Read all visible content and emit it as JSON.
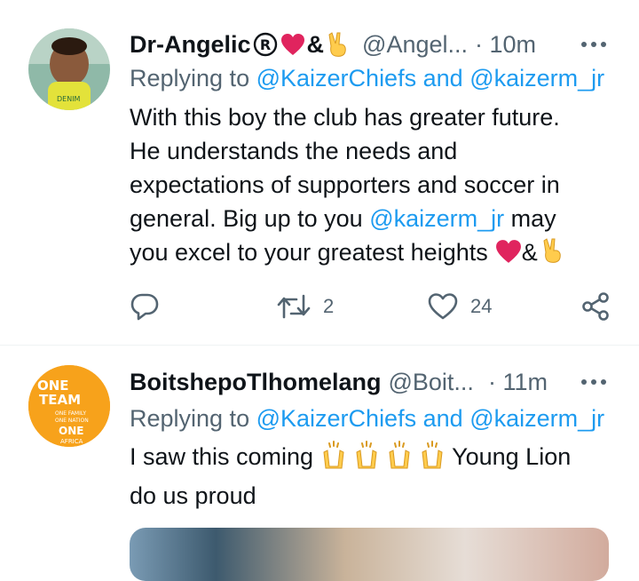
{
  "tweets": [
    {
      "name": "Dr-Angelic",
      "handle": "@Angel...",
      "time": "· 10m",
      "replying_prefix": "Replying to",
      "reply_user1": "@KaizerChiefs",
      "reply_and": "and",
      "reply_user2": "@kaizerm_jr",
      "body_lines": [
        "With this boy the club has greater future.",
        "He understands the needs and",
        "expectations of supporters and soccer in",
        "general. Big up to you",
        "@kaizerm_jr",
        "may",
        "you excel to your greatest heights"
      ],
      "amp": "&",
      "reply_count": "",
      "retweet_count": "2",
      "like_count": "24"
    },
    {
      "name": "BoitshepoTlhomelang",
      "handle": "@Boit...",
      "time": "· 11m",
      "replying_prefix": "Replying to",
      "reply_user1": "@KaizerChiefs",
      "reply_and": "and",
      "reply_user2": "@kaizerm_jr",
      "body_lines": [
        "I saw this coming",
        "Young Lion",
        "do us proud"
      ],
      "avatar_text": [
        "ONE",
        "TEAM",
        "ONE FAMILY",
        "ONE NATION",
        "ONE",
        "AFRICA"
      ]
    }
  ],
  "colors": {
    "link": "#1d9bf0",
    "secondary": "#536471",
    "heart": "#e0245e",
    "avatar2_bg": "#f7a21b"
  },
  "icons": [
    "reply-icon",
    "retweet-icon",
    "like-icon",
    "share-icon",
    "more-icon",
    "registered-icon",
    "heart-emoji",
    "victory-hand-emoji",
    "raised-hands-emoji"
  ]
}
